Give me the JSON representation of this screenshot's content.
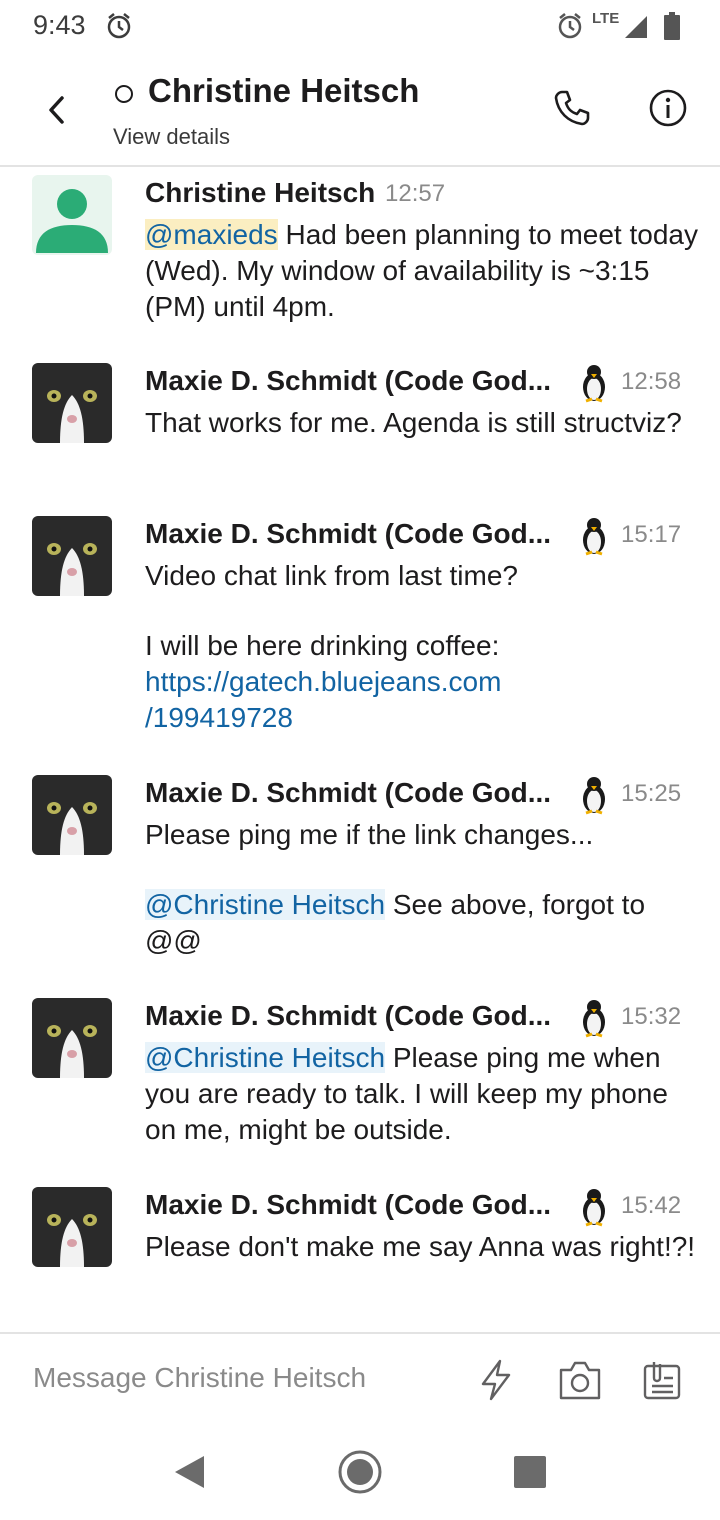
{
  "status_bar": {
    "time": "9:43",
    "network": "LTE",
    "icons": [
      "alarm-icon",
      "alarm-icon",
      "signal-icon",
      "battery-icon"
    ]
  },
  "header": {
    "title": "Christine Heitsch",
    "subtitle": "View details",
    "icons": [
      "back-icon",
      "presence-away-icon",
      "phone-icon",
      "info-icon"
    ]
  },
  "messages": [
    {
      "author": "Christine Heitsch",
      "time": "12:57",
      "mention": "@maxieds",
      "text": " Had been planning to meet today (Wed).  My window of availability is ~3:15 (PM) until 4pm."
    },
    {
      "author": "Maxie D. Schmidt (Code God...",
      "time": "12:58",
      "text": "That works for me. Agenda is still structviz?"
    },
    {
      "author": "Maxie D. Schmidt (Code God...",
      "time": "15:17",
      "text": "Video chat link from last time?",
      "text2": "I will be here drinking coffee:",
      "link_line1": "https://gatech.bluejeans.com",
      "link_line2": "/199419728"
    },
    {
      "author": "Maxie D. Schmidt (Code God...",
      "time": "15:25",
      "text": "Please ping me if the link changes...",
      "mention": "@Christine Heitsch",
      "text2": " See above, forgot to @@"
    },
    {
      "author": "Maxie D. Schmidt (Code God...",
      "time": "15:32",
      "mention": "@Christine Heitsch",
      "text": " Please ping me when you are ready to talk. I will keep my phone on me, might be outside."
    },
    {
      "author": "Maxie D. Schmidt (Code God...",
      "time": "15:42",
      "text": "Please don't make me say Anna was right!?!"
    }
  ],
  "composer": {
    "placeholder": "Message Christine Heitsch",
    "icons": [
      "lightning-icon",
      "camera-icon",
      "attachment-icon"
    ]
  },
  "nav": {
    "icons": [
      "nav-back-icon",
      "nav-home-icon",
      "nav-recents-icon"
    ]
  },
  "colors": {
    "link": "#1264a3",
    "self_mention_bg": "#fbeec1",
    "mention_bg": "#e8f3fa",
    "timestamp": "#8a8a8a",
    "default_avatar": "#2bac76"
  }
}
